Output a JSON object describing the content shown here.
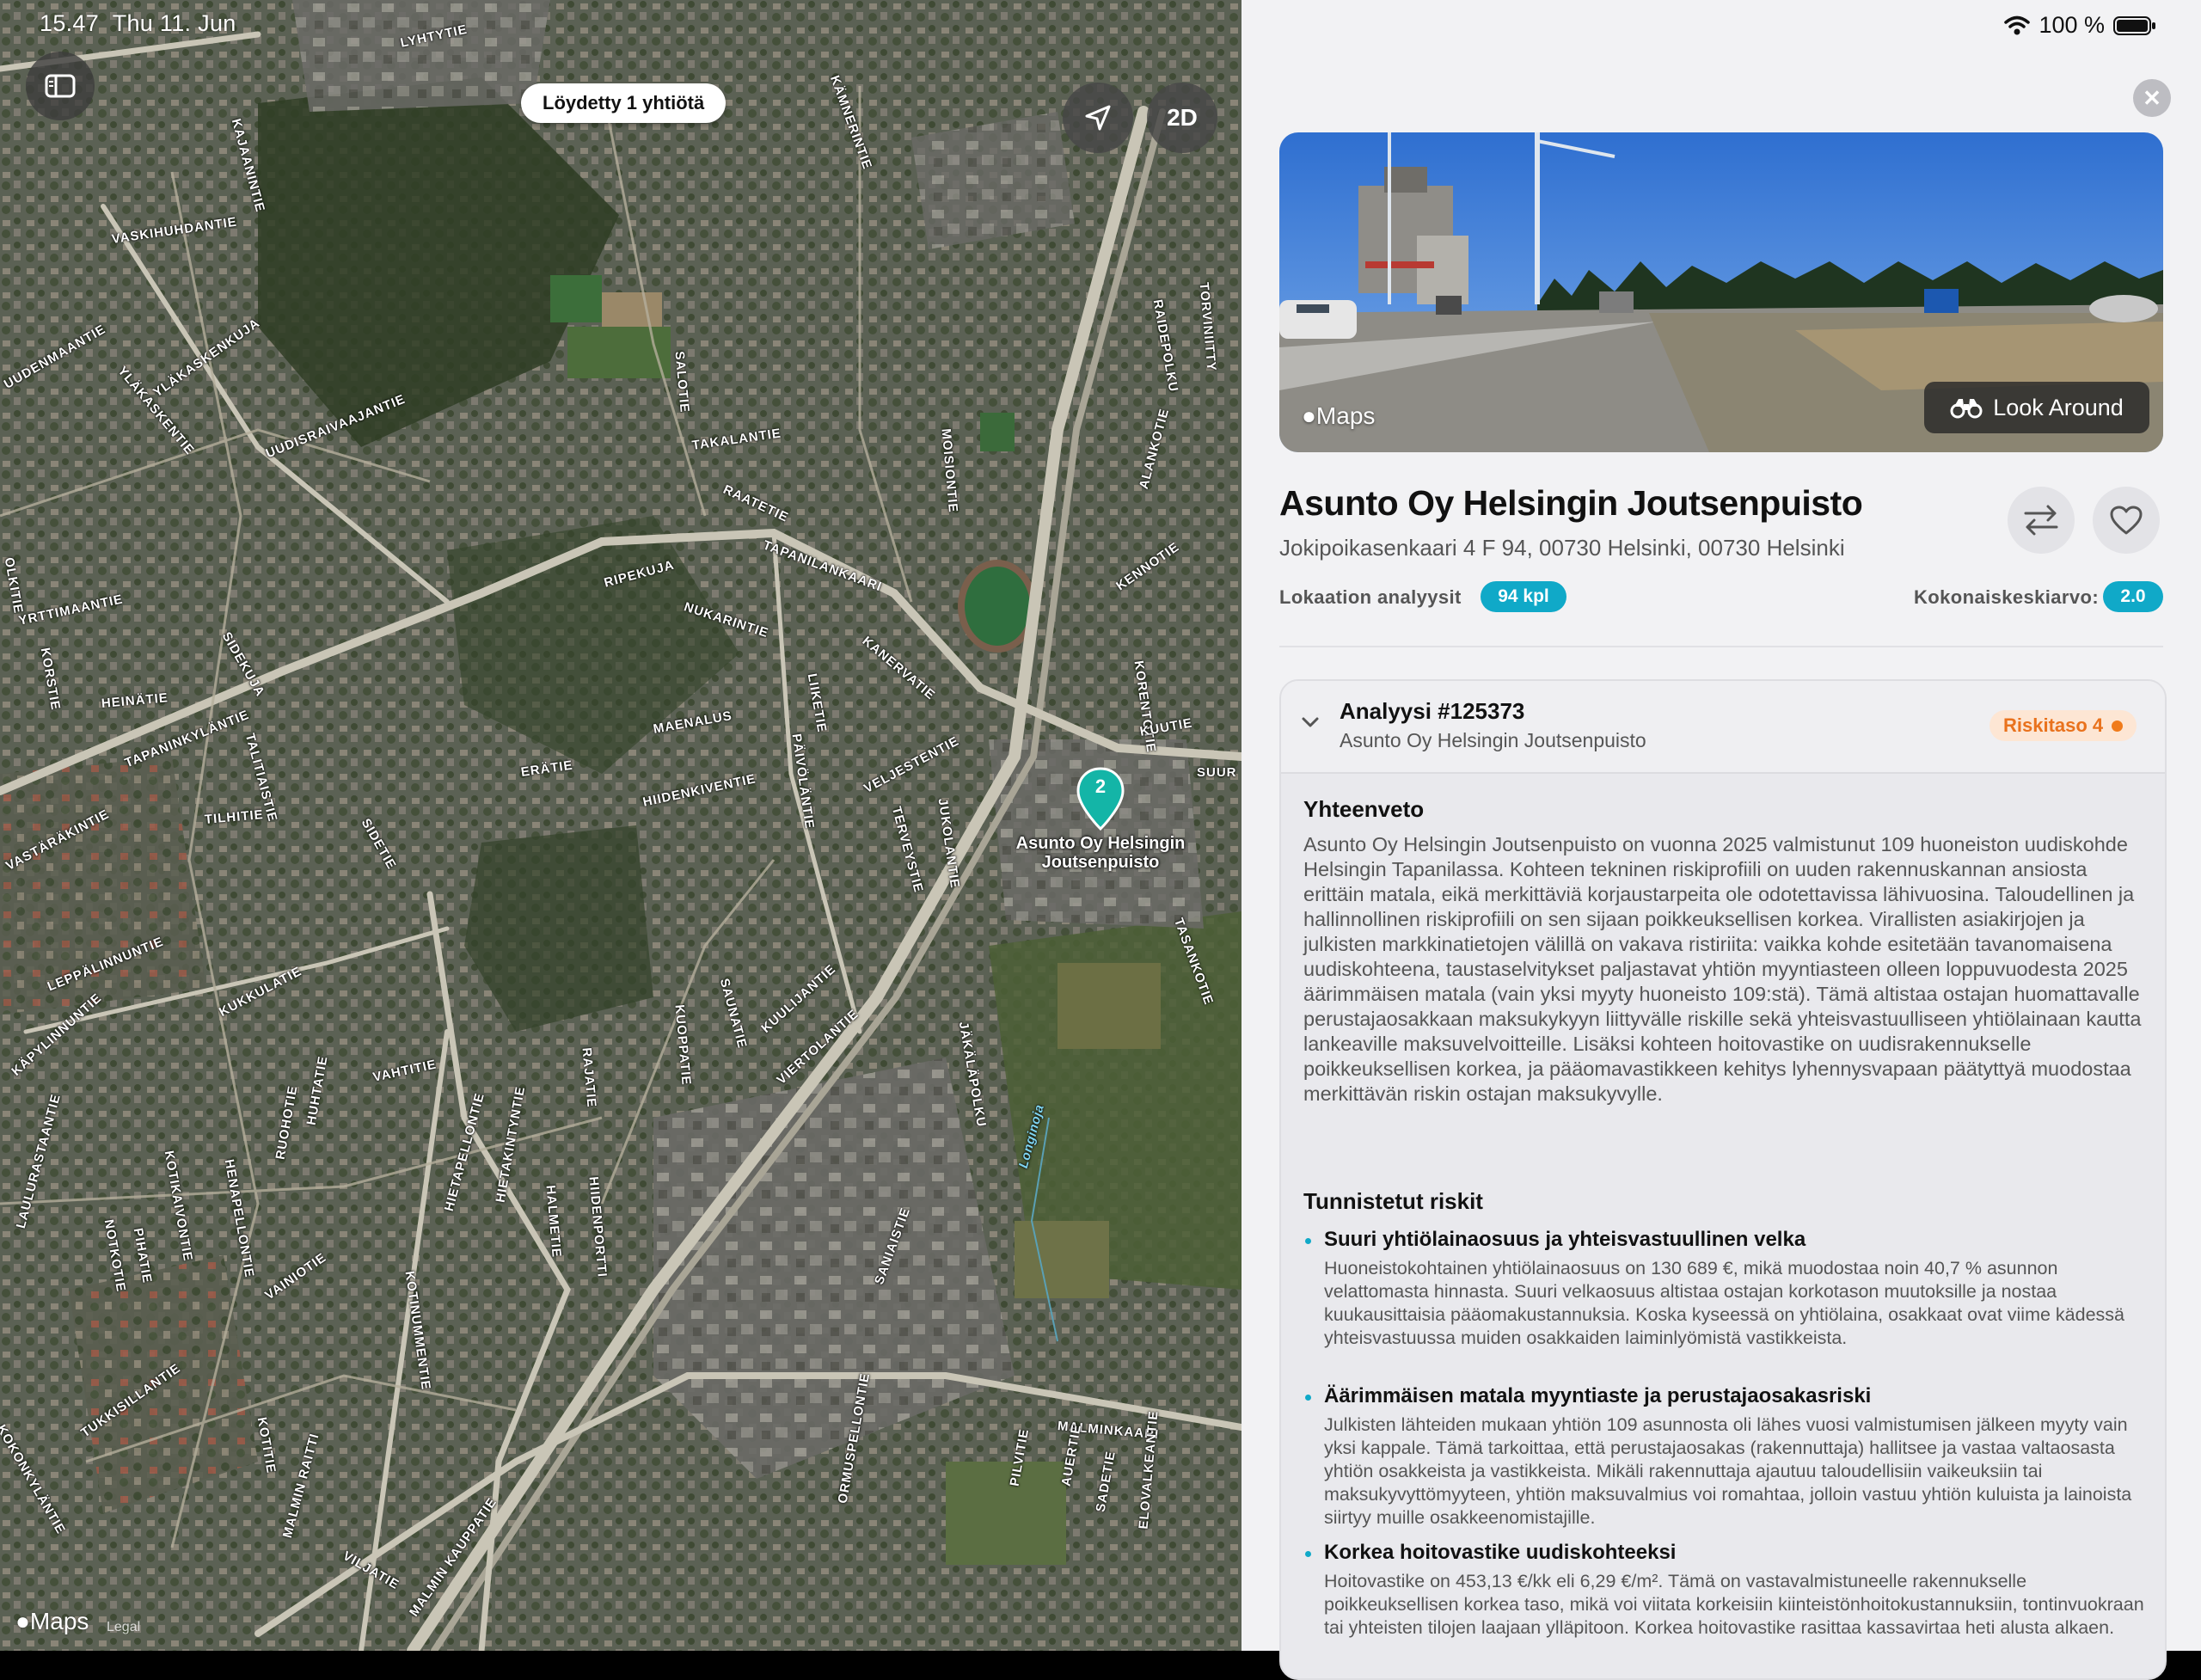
{
  "status": {
    "time": "15.47",
    "date": "Thu 11. Jun",
    "battery": "100 %"
  },
  "map": {
    "found_label": "Löydetty 1 yhtiötä",
    "mode_2d": "2D",
    "pin_count": "2",
    "pin_label_line1": "Asunto Oy Helsingin",
    "pin_label_line2": "Joutsenpuisto",
    "maps_logo": "Maps",
    "legal": "Legal",
    "streets": [
      "LYHTYTIE",
      "KÄMNERINTIE",
      "VASKIHUHDANTIE",
      "YLÄKASKENKUJA",
      "YLÄKASKENTIE",
      "UUDISRAIVAAJANTIE",
      "SALOTIE",
      "TAKALANTIE",
      "MOISIONTIE",
      "RAATETIE",
      "TAPANILANKAARI",
      "RIPEKUJA",
      "NUKARINTIE",
      "KANERVATIE",
      "YRTTIMAANTIE",
      "KORSTIE",
      "HEINÄTIE",
      "SIDEKUJA",
      "MAENALUS",
      "LIIKETIE",
      "ERÄTIE",
      "HIIDENKIVENTIE",
      "PÄIVÖLÄNTIE",
      "VELJESTENTIE",
      "TERVEYSTIE",
      "JUKOLANTIE",
      "TAPANINKYLÄNTIE",
      "TALITIAISTIE",
      "TILHITIE",
      "SIDETIE",
      "VASTÄRÄKINTIE",
      "LEPPÄLINNUNTIE",
      "KUKKULATIE",
      "SAUNATIE",
      "KUOPPATIE",
      "KUULIJANTIE",
      "VIERTOLANTIE",
      "JÄKÄLÄPOLKU",
      "KÄPYLINNUNTIE",
      "VAHTITIE",
      "RAJATIE",
      "HALMETIE",
      "HIIDENPORTTI",
      "HIETAPELLONTIE",
      "HIETAKINTYNTIE",
      "KOTIKAIVONTIE",
      "HENAPELLONTIE",
      "RUOHOTIE",
      "HUHTATIE",
      "NOTKOTIE",
      "PIHATIE",
      "LAULURASTAANTIE",
      "VAINIOTIE",
      "KOTINUMMENTIE",
      "SANIAISTIE",
      "MALMINKAARI",
      "TUKKISILLANTIE",
      "KOTITIE",
      "MALMIN RAITTI",
      "VILJATIE",
      "MALMIN KAUPPATIE",
      "ORMUSPELLONTIE",
      "PILVITIE",
      "AUERTIE",
      "SADETIE",
      "ELOVALKEANTIE",
      "KOKONKYLÄNTIE",
      "RAIDEPOLKU",
      "ALANKOTIE",
      "KENNOTIE",
      "KORENTOTIE",
      "KUUTIE",
      "SUUR",
      "TASANKOTIE",
      "Longinoja",
      "TORVINIITTY",
      "KAJAANINTIE",
      "OLKITIE",
      "UUDENMAANTIE"
    ]
  },
  "panel": {
    "photo_maps": "Maps",
    "look_around": "Look Around",
    "title": "Asunto Oy Helsingin Joutsenpuisto",
    "address": "Jokipoikasenkaari 4 F 94, 00730 Helsinki, 00730 Helsinki",
    "location_label": "Lokaation analyysit",
    "location_count": "94 kpl",
    "overall_label": "Kokonaiskeskiarvo:",
    "overall_value": "2.0",
    "analysis": {
      "title": "Analyysi #125373",
      "subtitle": "Asunto Oy Helsingin Joutsenpuisto",
      "risk_level": "Riskitaso 4",
      "summary_heading": "Yhteenveto",
      "summary": "Asunto Oy Helsingin Joutsenpuisto on vuonna 2025 valmistunut 109 huoneiston uudiskohde Helsingin Tapanilassa. Kohteen tekninen riskiprofiili on uuden rakennuskannan ansiosta erittäin matala, eikä merkittäviä korjaustarpeita ole odotettavissa lähivuosina. Taloudellinen ja hallinnollinen riskiprofiili on sen sijaan poikkeuksellisen korkea. Virallisten asiakirjojen ja julkisten markkinatietojen välillä on vakava ristiriita: vaikka kohde esitetään tavanomaisena uudiskohteena, taustaselvitykset paljastavat yhtiön myyntiasteen olleen loppuvuodesta 2025 äärimmäisen matala (vain yksi myyty huoneisto 109:stä). Tämä altistaa ostajan huomattavalle perustajaosakkaan maksukykyyn liittyvälle riskille sekä yhteisvastuulliseen yhtiölainaan kautta lankeaville maksuvelvoitteille. Lisäksi kohteen hoitovastike on uudisrakennukselle poikkeuksellisen korkea, ja pääomavastikkeen kehitys lyhennysvapaan päätyttyä muodostaa merkittävän riskin ostajan maksukyvylle.",
      "risks_heading": "Tunnistetut riskit",
      "risks": [
        {
          "title": "Suuri yhtiölainaosuus ja yhteisvastuullinen velka",
          "text": "Huoneistokohtainen yhtiölainaosuus on 130 689 €, mikä muodostaa noin 40,7 % asunnon velattomasta hinnasta. Suuri velkaosuus altistaa ostajan korkotason muutoksille ja nostaa kuukausittaisia pääomakustannuksia. Koska kyseessä on yhtiölaina, osakkaat ovat viime kädessä yhteisvastuussa muiden osakkaiden laiminlyömistä vastikkeista."
        },
        {
          "title": "Äärimmäisen matala myyntiaste ja perustajaosakasriski",
          "text": "Julkisten lähteiden mukaan yhtiön 109 asunnosta oli lähes vuosi valmistumisen jälkeen myyty vain yksi kappale. Tämä tarkoittaa, että perustajaosakas (rakennuttaja) hallitsee ja vastaa valtaosasta yhtiön osakkeista ja vastikkeista. Mikäli rakennuttaja ajautuu taloudellisiin vaikeuksiin tai maksukyvyttömyyteen, yhtiön maksuvalmius voi romahtaa, jolloin vastuu yhtiön kuluista ja lainoista siirtyy muille osakkeenomistajille."
        },
        {
          "title": "Korkea hoitovastike uudiskohteeksi",
          "text": "Hoitovastike on 453,13 €/kk eli 6,29 €/m². Tämä on vastavalmistuneelle rakennukselle poikkeuksellisen korkea taso, mikä voi viitata korkeisiin kiinteistönhoitokustannuksiin, tontinvuokraan tai yhteisten tilojen laajaan ylläpitoon. Korkea hoitovastike rasittaa kassavirtaa heti alusta alkaen."
        }
      ]
    }
  },
  "colors": {
    "accent": "#10a9c8",
    "risk": "#f07b1b",
    "risk_bg": "#fde6d4"
  }
}
